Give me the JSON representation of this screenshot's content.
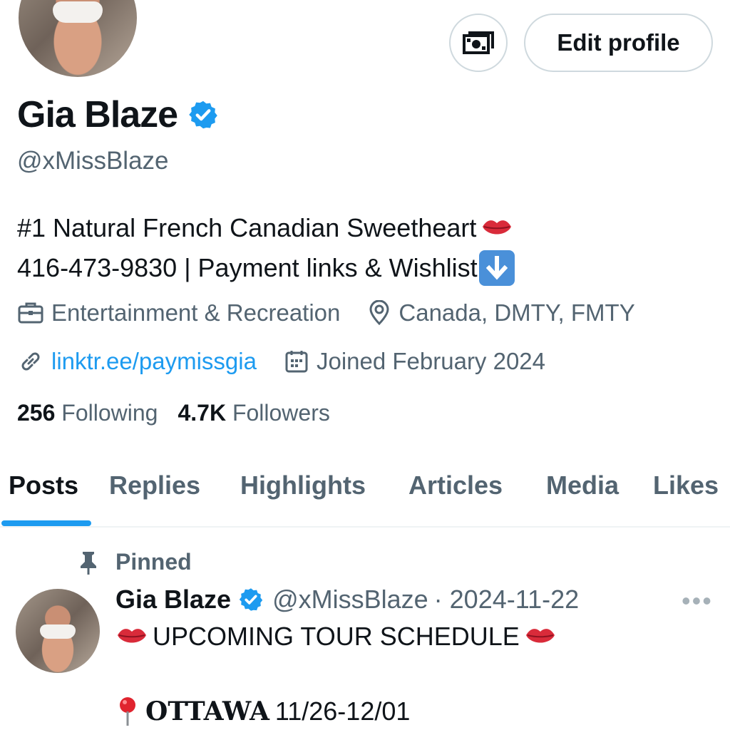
{
  "header": {
    "edit_profile_label": "Edit profile",
    "tip_icon": "money-icon"
  },
  "profile": {
    "name": "Gia Blaze",
    "handle": "@xMissBlaze",
    "verified_icon": "verified-badge-icon",
    "bio_line1": "#1 Natural French Canadian Sweetheart",
    "bio_line2": "416-473-9830 | Payment links & Wishlist",
    "category": "Entertainment & Recreation",
    "location": "Canada, DMTY, FMTY",
    "link": "linktr.ee/paymissgia",
    "joined": "Joined February 2024",
    "following_count": "256",
    "following_label": "Following",
    "followers_count": "4.7K",
    "followers_label": "Followers"
  },
  "tabs": [
    {
      "label": "Posts"
    },
    {
      "label": "Replies"
    },
    {
      "label": "Highlights"
    },
    {
      "label": "Articles"
    },
    {
      "label": "Media"
    },
    {
      "label": "Likes"
    }
  ],
  "pinned_post": {
    "pinned_label": "Pinned",
    "author_name": "Gia Blaze",
    "author_handle": "@xMissBlaze",
    "date": "· 2024-11-22",
    "more_label": "•••",
    "text_line1": "UPCOMING TOUR SCHEDULE",
    "city": "OTTAWA",
    "dates": "11/26-12/01"
  },
  "colors": {
    "accent": "#1d9bf0",
    "secondary_text": "#536471",
    "border": "#cfd9de"
  }
}
